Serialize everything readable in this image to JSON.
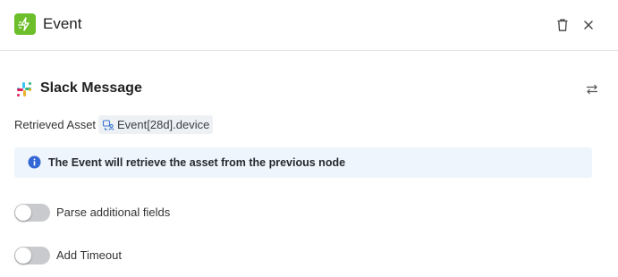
{
  "header": {
    "title": "Event",
    "icon": "event-lightning-icon",
    "icon_color": "#6cbf2a"
  },
  "integration": {
    "name": "Slack Message",
    "logo": "slack-logo"
  },
  "retrieved_asset": {
    "label": "Retrieved Asset",
    "value": "Event[28d].device",
    "icon": "asset-reference-icon"
  },
  "info_banner": {
    "text": "The Event will retrieve the asset from the previous node",
    "icon": "info-icon",
    "color": "#3367d6"
  },
  "toggles": [
    {
      "label": "Parse additional fields",
      "enabled": false
    },
    {
      "label": "Add Timeout",
      "enabled": false
    }
  ]
}
